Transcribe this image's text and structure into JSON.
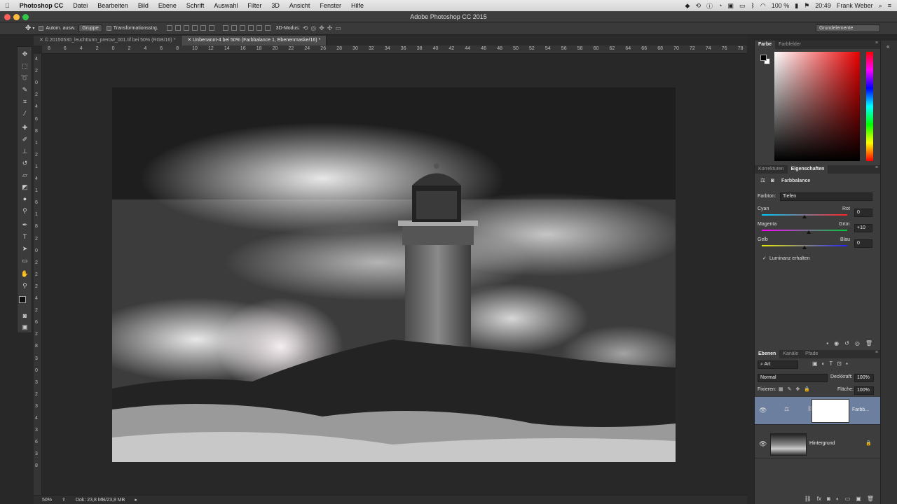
{
  "menubar": {
    "app_name": "Photoshop CC",
    "items": [
      "Datei",
      "Bearbeiten",
      "Bild",
      "Ebene",
      "Schrift",
      "Auswahl",
      "Filter",
      "3D",
      "Ansicht",
      "Fenster",
      "Hilfe"
    ],
    "battery": "100 %",
    "time": "20:49",
    "user": "Frank Weber"
  },
  "titlebar": {
    "title": "Adobe Photoshop CC 2015"
  },
  "optionsbar": {
    "auto_select_label": "Autom. ausw.:",
    "auto_select_value": "Gruppe",
    "transform_label": "Transformationsstrg.",
    "mode_3d_label": "3D-Modus:",
    "workspace": "Grundelemente"
  },
  "doc_tabs": [
    {
      "label": "© 20150530_leuchtturm_prerow_001.tif bei 50% (RGB/16) *"
    },
    {
      "label": "Unbenannt-4 bei 50% (Farbbalance 1, Ebenenmaske/16) *"
    }
  ],
  "ruler_h": [
    "8",
    "6",
    "4",
    "2",
    "0",
    "2",
    "4",
    "6",
    "8",
    "10",
    "12",
    "14",
    "16",
    "18",
    "20",
    "22",
    "24",
    "26",
    "28",
    "30",
    "32",
    "34",
    "36",
    "38",
    "40",
    "42",
    "44",
    "46",
    "48",
    "50",
    "52",
    "54",
    "56",
    "58",
    "60",
    "62",
    "64",
    "66",
    "68",
    "70",
    "72",
    "74",
    "76",
    "78"
  ],
  "ruler_v": [
    "4",
    "2",
    "0",
    "2",
    "4",
    "6",
    "8",
    "1",
    "2",
    "1",
    "4",
    "1",
    "6",
    "1",
    "8",
    "2",
    "0",
    "2",
    "2",
    "2",
    "4",
    "2",
    "6",
    "2",
    "8",
    "3",
    "0",
    "3",
    "2",
    "3",
    "4",
    "3",
    "6",
    "3",
    "8"
  ],
  "status": {
    "zoom": "50%",
    "doc_label": "Dok: 23,8 MB/23,8 MB"
  },
  "color_panel": {
    "tabs": [
      "Farbe",
      "Farbfelder"
    ]
  },
  "properties_panel": {
    "tabs": [
      "Korrekturen",
      "Eigenschaften"
    ],
    "title": "Farbbalance",
    "tone_label": "Farbton:",
    "tone_value": "Tiefen",
    "sliders": [
      {
        "left": "Cyan",
        "right": "Rot",
        "value": "0",
        "level": 0
      },
      {
        "left": "Magenta",
        "right": "Grün",
        "value": "+10",
        "level": 10
      },
      {
        "left": "Gelb",
        "right": "Blau",
        "value": "0",
        "level": 0
      }
    ],
    "preserve_luminosity": "Luminanz erhalten"
  },
  "layers_panel": {
    "tabs": [
      "Ebenen",
      "Kanäle",
      "Pfade"
    ],
    "filter_kind": "Art",
    "blend_mode": "Normal",
    "opacity_label": "Deckkraft:",
    "opacity": "100%",
    "lock_label": "Fixieren:",
    "fill_label": "Fläche:",
    "fill": "100%",
    "layers": [
      {
        "name": "Farbb...",
        "selected": true
      },
      {
        "name": "Hintergrund",
        "selected": false
      }
    ]
  }
}
